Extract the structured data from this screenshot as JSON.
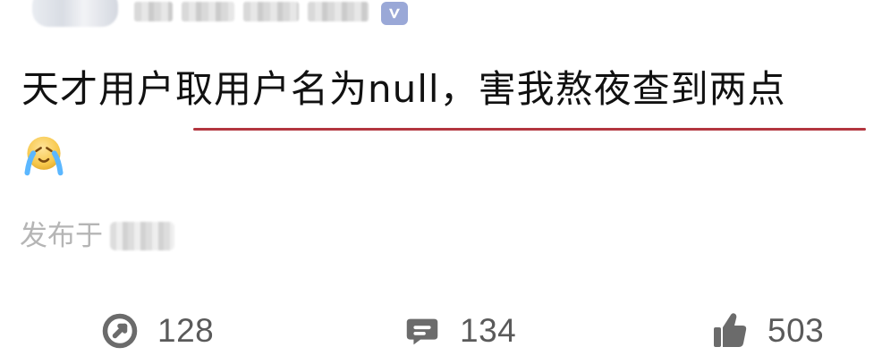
{
  "header": {
    "avatar": "blurred-avatar",
    "author_name": "",
    "verified_badge_icon": "verified-v-icon"
  },
  "post": {
    "text": "天才用户取用户名为null，害我熬夜查到两点",
    "emoji_icon": "crying-face-emoji",
    "underline_color": "#b3363f"
  },
  "meta": {
    "publish_label": "发布于",
    "publish_value": ""
  },
  "actions": {
    "repost": {
      "icon": "repost-icon",
      "count": "128"
    },
    "comment": {
      "icon": "comment-icon",
      "count": "134"
    },
    "like": {
      "icon": "thumbs-up-icon",
      "count": "503"
    }
  }
}
